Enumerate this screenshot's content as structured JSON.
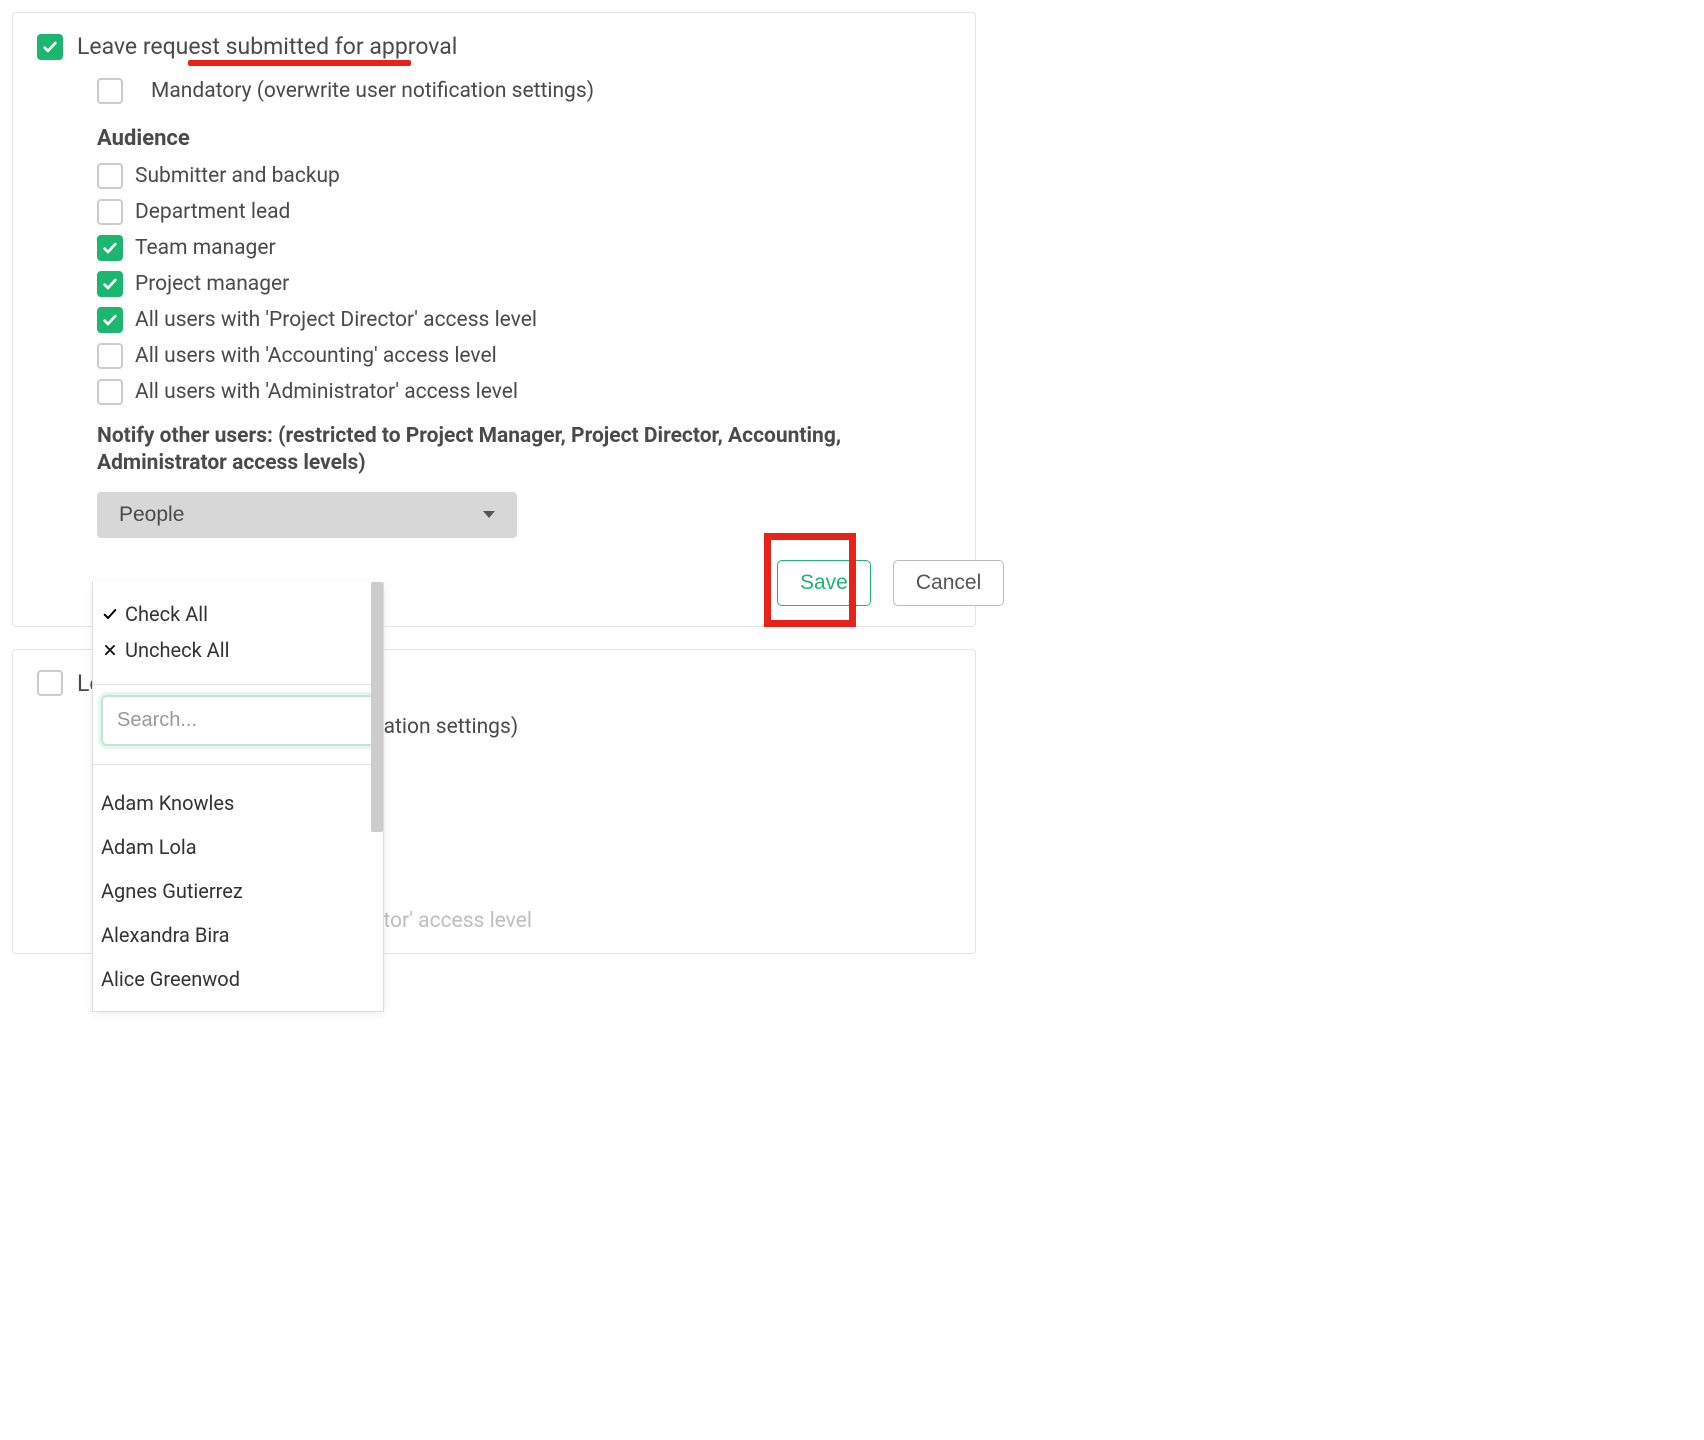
{
  "panel1": {
    "title": "Leave request submitted for approval",
    "mandatory_label": "Mandatory (overwrite user notification settings)",
    "audience_heading": "Audience",
    "audience": [
      {
        "label": "Submitter and backup",
        "checked": false
      },
      {
        "label": "Department lead",
        "checked": false
      },
      {
        "label": "Team manager",
        "checked": true
      },
      {
        "label": "Project manager",
        "checked": true
      },
      {
        "label": "All users with 'Project Director' access level",
        "checked": true
      },
      {
        "label": "All users with 'Accounting' access level",
        "checked": false
      },
      {
        "label": "All users with 'Administrator' access level",
        "checked": false
      }
    ],
    "notify_heading": "Notify other users: (restricted to Project Manager, Project Director, Accounting, Administrator access levels)",
    "dropdown_label": "People",
    "save_label": "Save",
    "cancel_label": "Cancel"
  },
  "dropdown": {
    "check_all": "Check All",
    "uncheck_all": "Uncheck All",
    "search_placeholder": "Search...",
    "people": [
      "Adam Knowles",
      "Adam Lola",
      "Agnes Gutierrez",
      "Alexandra Bira",
      "Alice Greenwod"
    ]
  },
  "panel2": {
    "title_prefix": "Lea",
    "mandatory_tail": "otification settings)",
    "faded_row": "All users with 'Project Director' access level"
  }
}
